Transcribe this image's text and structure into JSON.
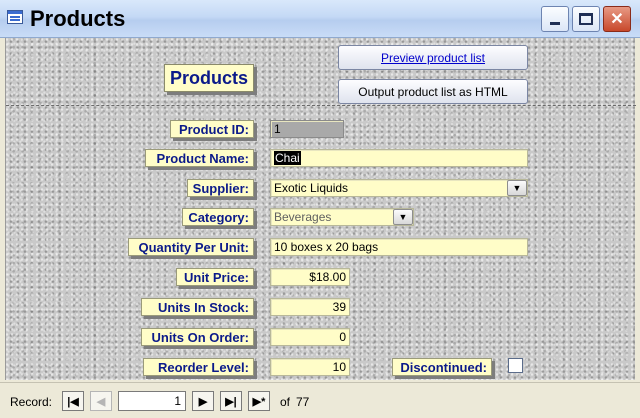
{
  "window": {
    "title": "Products"
  },
  "header": {
    "label": "Products",
    "preview_button": "Preview product list",
    "output_button": "Output product list as HTML"
  },
  "fields": {
    "product_id": {
      "label": "Product ID:",
      "value": "1"
    },
    "product_name": {
      "label": "Product Name:",
      "value": "Chai"
    },
    "supplier": {
      "label": "Supplier:",
      "value": "Exotic Liquids"
    },
    "category": {
      "label": "Category:",
      "value": "Beverages"
    },
    "quantity_per_unit": {
      "label": "Quantity Per Unit:",
      "value": "10 boxes x 20 bags"
    },
    "unit_price": {
      "label": "Unit Price:",
      "value": "$18.00"
    },
    "units_in_stock": {
      "label": "Units In Stock:",
      "value": "39"
    },
    "units_on_order": {
      "label": "Units On Order:",
      "value": "0"
    },
    "reorder_level": {
      "label": "Reorder Level:",
      "value": "10"
    },
    "discontinued": {
      "label": "Discontinued:",
      "checked": false
    }
  },
  "navigator": {
    "label": "Record:",
    "current": "1",
    "of_label": "of",
    "total": "77",
    "first_glyph": "|◀",
    "prev_glyph": "◀",
    "next_glyph": "▶",
    "last_glyph": "▶|",
    "new_glyph": "▶*"
  },
  "icons": {
    "app": "form-icon",
    "dropdown": "chevron-down-icon"
  },
  "colors": {
    "label_bg": "#fffdc8",
    "label_text": "#0b1a8a",
    "close_button": "#c8482b"
  }
}
